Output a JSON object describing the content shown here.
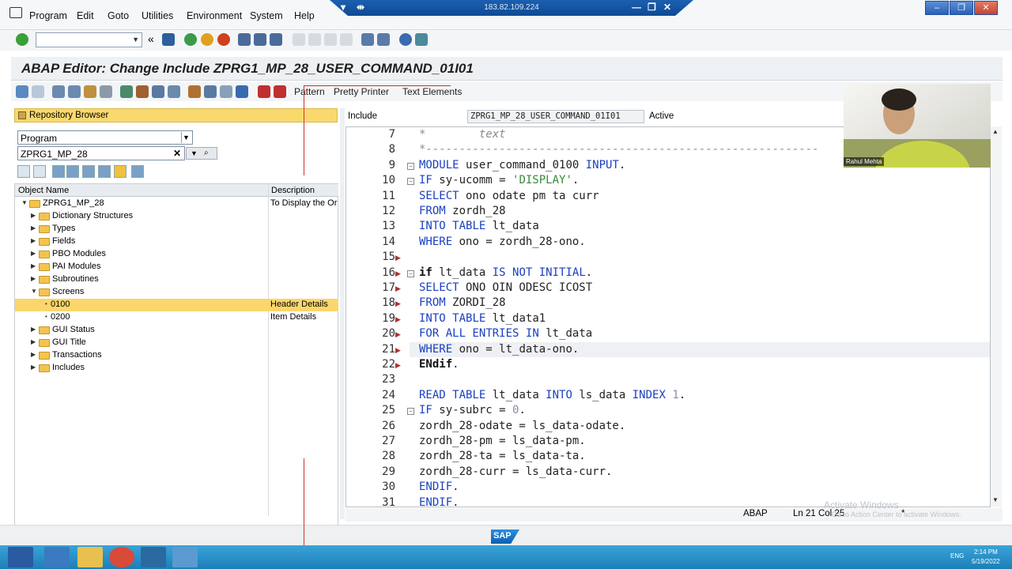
{
  "menu": {
    "items": [
      "Program",
      "Edit",
      "Goto",
      "Utilities",
      "Environment",
      "System",
      "Help"
    ],
    "remote_ip": "183.82.109.224"
  },
  "title": "ABAP Editor: Change Include ZPRG1_MP_28_USER_COMMAND_01I01",
  "app_toolbar": {
    "pattern": "Pattern",
    "pretty_printer": "Pretty Printer",
    "text_elements": "Text Elements"
  },
  "repository": {
    "header": "Repository Browser",
    "object_type": "Program",
    "object_name": "ZPRG1_MP_28",
    "columns": [
      "Object Name",
      "Description"
    ],
    "tree": [
      {
        "name": "ZPRG1_MP_28",
        "desc": "To Display the Or",
        "level": 0,
        "folder": true,
        "expanded": true
      },
      {
        "name": "Dictionary Structures",
        "desc": "",
        "level": 1,
        "folder": true
      },
      {
        "name": "Types",
        "desc": "",
        "level": 1,
        "folder": true
      },
      {
        "name": "Fields",
        "desc": "",
        "level": 1,
        "folder": true
      },
      {
        "name": "PBO Modules",
        "desc": "",
        "level": 1,
        "folder": true
      },
      {
        "name": "PAI Modules",
        "desc": "",
        "level": 1,
        "folder": true
      },
      {
        "name": "Subroutines",
        "desc": "",
        "level": 1,
        "folder": true
      },
      {
        "name": "Screens",
        "desc": "",
        "level": 1,
        "folder": true,
        "expanded": true
      },
      {
        "name": "0100",
        "desc": "Header Details",
        "level": 2,
        "folder": false,
        "selected": true
      },
      {
        "name": "0200",
        "desc": "Item Details",
        "level": 2,
        "folder": false
      },
      {
        "name": "GUI Status",
        "desc": "",
        "level": 1,
        "folder": true
      },
      {
        "name": "GUI Title",
        "desc": "",
        "level": 1,
        "folder": true
      },
      {
        "name": "Transactions",
        "desc": "",
        "level": 1,
        "folder": true
      },
      {
        "name": "Includes",
        "desc": "",
        "level": 1,
        "folder": true
      }
    ]
  },
  "editor": {
    "include_label": "Include",
    "include_name": "ZPRG1_MP_28_USER_COMMAND_01I01",
    "status": "Active",
    "lines": [
      {
        "n": "7",
        "t": "*        text"
      },
      {
        "n": "8",
        "t": "*-----------------------------------------------------------"
      },
      {
        "n": "9",
        "t": "MODULE user_command_0100 INPUT."
      },
      {
        "n": "10",
        "t": "IF sy-ucomm = 'DISPLAY'."
      },
      {
        "n": "11",
        "t": "SELECT ono odate pm ta curr"
      },
      {
        "n": "12",
        "t": "FROM zordh_28"
      },
      {
        "n": "13",
        "t": "INTO TABLE lt_data"
      },
      {
        "n": "14",
        "t": "WHERE ono = zordh_28-ono."
      },
      {
        "n": "15",
        "t": ""
      },
      {
        "n": "16",
        "t": "if lt_data IS NOT INITIAL."
      },
      {
        "n": "17",
        "t": "SELECT ONO OIN ODESC ICOST"
      },
      {
        "n": "18",
        "t": "FROM ZORDI_28"
      },
      {
        "n": "19",
        "t": "INTO TABLE lt_data1"
      },
      {
        "n": "20",
        "t": "FOR ALL ENTRIES IN lt_data"
      },
      {
        "n": "21",
        "t": "WHERE ono = lt_data-ono."
      },
      {
        "n": "22",
        "t": "ENdif."
      },
      {
        "n": "23",
        "t": ""
      },
      {
        "n": "24",
        "t": "READ TABLE lt_data INTO ls_data INDEX 1."
      },
      {
        "n": "25",
        "t": "IF sy-subrc = 0."
      },
      {
        "n": "26",
        "t": "zordh_28-odate = ls_data-odate."
      },
      {
        "n": "27",
        "t": "zordh_28-pm = ls_data-pm."
      },
      {
        "n": "28",
        "t": "zordh_28-ta = ls_data-ta."
      },
      {
        "n": "29",
        "t": "zordh_28-curr = ls_data-curr."
      },
      {
        "n": "30",
        "t": "ENDIF."
      },
      {
        "n": "31",
        "t": "ENDIF."
      }
    ]
  },
  "status_bar": {
    "language": "ABAP",
    "position": "Ln 21 Col 25",
    "mode": "*"
  },
  "webcam": {
    "name": "Rahul Mehta"
  },
  "watermark": {
    "line1": "Activate Windows",
    "line2": "Go to Action Center to activate Windows."
  },
  "taskbar": {
    "lang": "ENG",
    "time": "2:14 PM",
    "date": "5/19/2022"
  },
  "footer": {
    "logo": "SAP"
  }
}
